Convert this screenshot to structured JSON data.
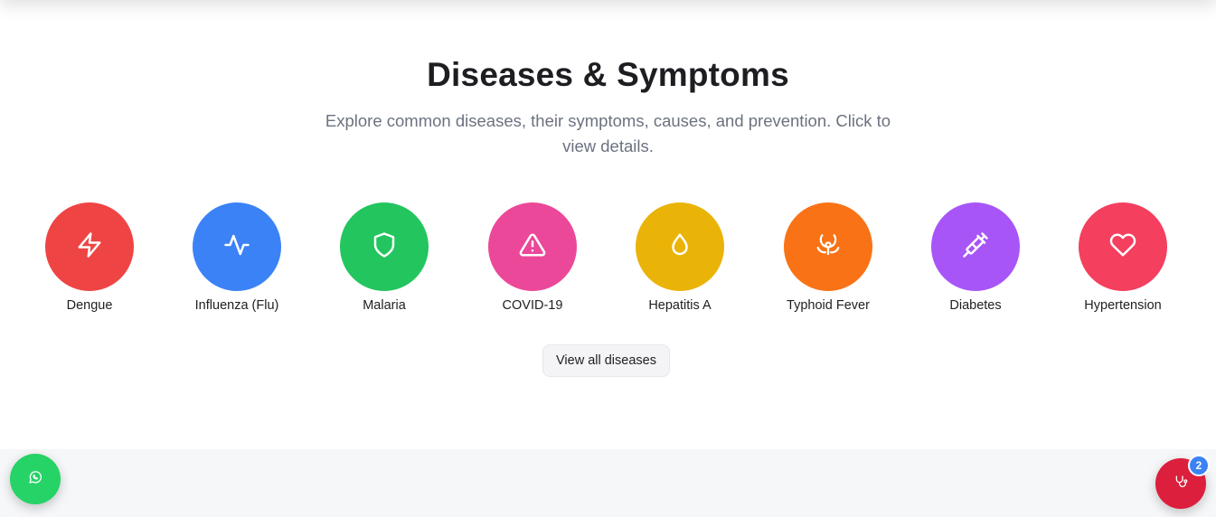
{
  "section": {
    "title": "Diseases & Symptoms",
    "subtitle": "Explore common diseases, their symptoms, causes, and prevention. Click to view details."
  },
  "diseases": [
    {
      "name": "Dengue",
      "color": "#ef4444",
      "icon": "zap-icon"
    },
    {
      "name": "Influenza (Flu)",
      "color": "#3b82f6",
      "icon": "activity-icon"
    },
    {
      "name": "Malaria",
      "color": "#22c55e",
      "icon": "shield-icon"
    },
    {
      "name": "COVID-19",
      "color": "#ec4899",
      "icon": "alert-triangle-icon"
    },
    {
      "name": "Hepatitis A",
      "color": "#eab308",
      "icon": "droplet-icon"
    },
    {
      "name": "Typhoid Fever",
      "color": "#f97316",
      "icon": "biohazard-icon"
    },
    {
      "name": "Diabetes",
      "color": "#a855f7",
      "icon": "syringe-icon"
    },
    {
      "name": "Hypertension",
      "color": "#f43f5e",
      "icon": "heart-icon"
    }
  ],
  "actions": {
    "view_all_label": "View all diseases"
  },
  "floating": {
    "whatsapp_icon": "whatsapp-icon",
    "doctor_icon": "stethoscope-icon",
    "badge_count": "2"
  }
}
